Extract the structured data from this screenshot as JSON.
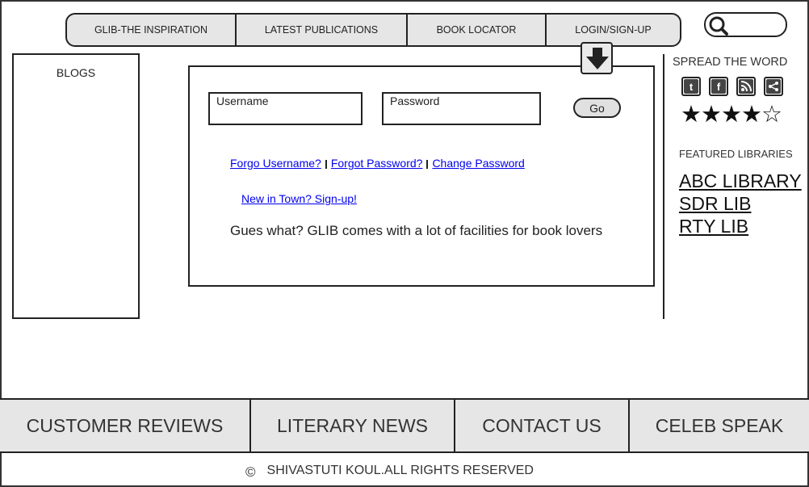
{
  "topnav": [
    "GLIB-THE INSPIRATION",
    "LATEST PUBLICATIONS",
    "BOOK LOCATOR",
    "LOGIN/SIGN-UP"
  ],
  "blogs_label": "BLOGS",
  "login": {
    "username_label": "Username",
    "password_label": "Password",
    "go_label": "Go",
    "links": [
      "Forgo Username?",
      "Forgot Password?",
      "Change Password"
    ],
    "signup": "New in Town? Sign-up!",
    "message": "Gues what? GLIB comes with a lot of facilities for book lovers"
  },
  "sidebar": {
    "spread_title": "SPREAD THE WORD",
    "social_icons": [
      "twitter-icon",
      "facebook-icon",
      "rss-icon",
      "share-icon"
    ],
    "rating_stars": "★★★★☆",
    "rating_value": 4,
    "rating_max": 5,
    "featured_title": "FEATURED LIBRARIES",
    "libraries": [
      "ABC LIBRARY",
      "SDR LIB",
      "RTY LIB"
    ]
  },
  "bottomnav": [
    "CUSTOMER REVIEWS",
    "LITERARY NEWS",
    "CONTACT US",
    "CELEB SPEAK"
  ],
  "footer": {
    "copyright_symbol": "©",
    "text": "SHIVASTUTI KOUL.ALL RIGHTS RESERVED"
  }
}
